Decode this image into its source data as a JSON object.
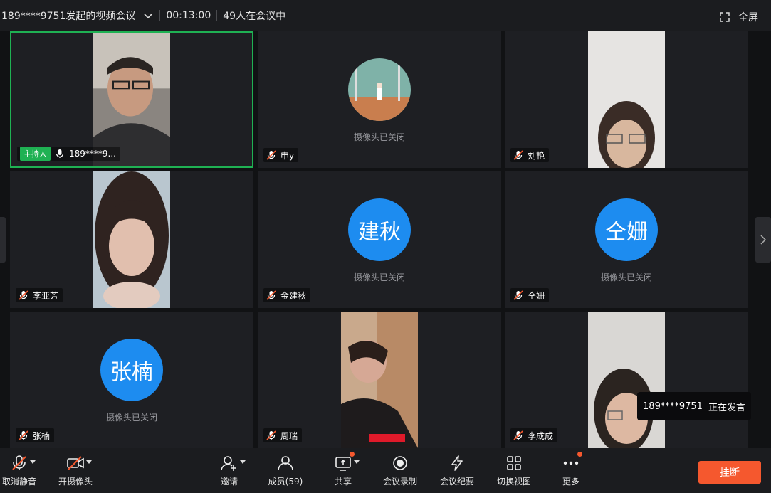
{
  "topbar": {
    "meeting_title": "189****9751发起的视频会议",
    "duration": "00:13:00",
    "participants": "49人在会议中",
    "fullscreen_label": "全屏"
  },
  "tiles": [
    {
      "name": "189****9...",
      "host_label": "主持人"
    },
    {
      "name": "申y",
      "cam_off": "摄像头已关闭"
    },
    {
      "name": "刘艳"
    },
    {
      "name": "李亚芳"
    },
    {
      "name": "金建秋",
      "avatar_text": "建秋",
      "cam_off": "摄像头已关闭"
    },
    {
      "name": "仝姗",
      "avatar_text": "仝姗",
      "cam_off": "摄像头已关闭"
    },
    {
      "name": "张楠",
      "avatar_text": "张楠",
      "cam_off": "摄像头已关闭"
    },
    {
      "name": "周瑞"
    },
    {
      "name": "李成成"
    }
  ],
  "speaking_toast": {
    "name": "189****9751",
    "status": "正在发言"
  },
  "toolbar": {
    "unmute": "取消静音",
    "camera": "开摄像头",
    "invite": "邀请",
    "members": "成员(59)",
    "share": "共享",
    "record": "会议录制",
    "minutes": "会议纪要",
    "switch_view": "切换视图",
    "more": "更多",
    "hangup": "挂断"
  },
  "colors": {
    "accent_green": "#1fb153",
    "avatar_blue": "#1d8cf0",
    "hangup_red": "#f5582e"
  }
}
